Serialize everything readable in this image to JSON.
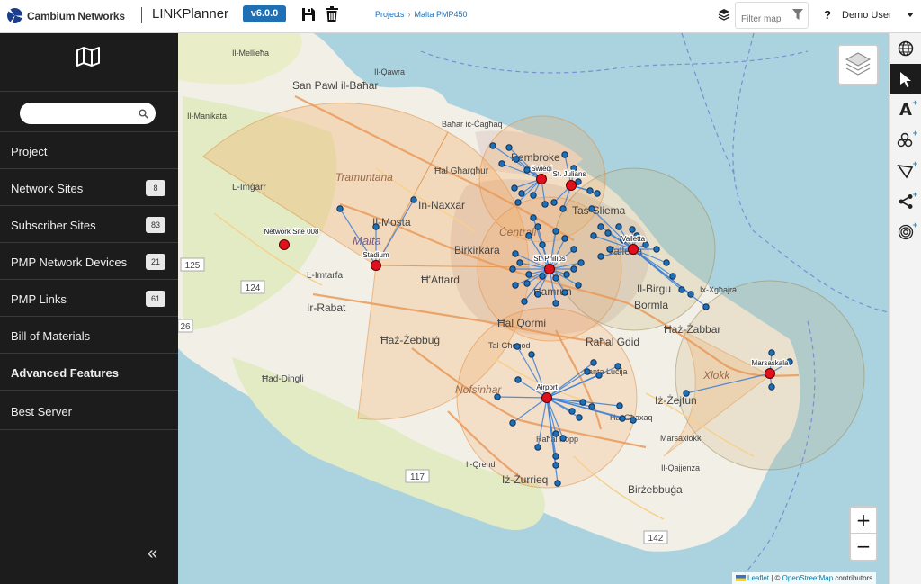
{
  "header": {
    "brand": "Cambium Networks",
    "app_title": "LINKPlanner",
    "version": "v6.0.0",
    "breadcrumb": [
      "Projects",
      "Malta PMP450"
    ],
    "filter_placeholder": "Filter map",
    "help": "?",
    "user": "Demo User",
    "icons": [
      "layers-icon",
      "save-icon",
      "trash-icon",
      "filter-icon",
      "caret-down-icon"
    ]
  },
  "sidebar": {
    "search_value": "",
    "items": [
      {
        "label": "Project",
        "badge": ""
      },
      {
        "label": "Network Sites",
        "badge": "8"
      },
      {
        "label": "Subscriber Sites",
        "badge": "83"
      },
      {
        "label": "PMP Network Devices",
        "badge": "21"
      },
      {
        "label": "PMP Links",
        "badge": "61"
      },
      {
        "label": "Bill of Materials",
        "badge": ""
      },
      {
        "label": "Advanced Features",
        "badge": ""
      },
      {
        "label": "Best Server",
        "badge": ""
      }
    ],
    "collapse": "«"
  },
  "map": {
    "place_labels": [
      "Il-Mellieħa",
      "Il-Qawra",
      "San Pawl il-Baħar",
      "Il-Manikata",
      "Baħar iċ-Ċagħaq",
      "Pembroke",
      "Ħal Għargħur",
      "Tramuntana",
      "L-Imġarr",
      "In-Naxxar",
      "Il-Mosta",
      "Tas-Sliema",
      "Birkirkara",
      "Ċentrali",
      "Malta",
      "Il-Birgu",
      "Bormla",
      "L-Imtarfa",
      "Ħ'Attard",
      "Ħamrun",
      "Ir-Rabat",
      "Ħal Qormi",
      "Ħaż-Żabbar",
      "Ħaż-Żebbuġ",
      "Raħal Ġdid",
      "Tal-Għoqod",
      "Ħad-Dingli",
      "Xlokk",
      "Iż-Żejtun",
      "Nofsinhar",
      "Ħal Għaxaq",
      "Marsaxlokk",
      "Il-Qrendi",
      "Iż-Żurrieq",
      "Il-Qajjenza",
      "Birżebbuġa",
      "Ix-Xgħajra",
      "Valletta",
      "Santa Luċija",
      "Raħal Kopp"
    ],
    "road_numbers": [
      "125",
      "124",
      "26",
      "117",
      "142"
    ],
    "site_labels": [
      "Network Site 008",
      "Stadium",
      "Swieqi",
      "St. Julians",
      "Valletta",
      "St. Philips",
      "Airport",
      "Marsaskala"
    ],
    "attribution": {
      "leaflet": "Leaflet",
      "sep": " | © ",
      "osm": "OpenStreetMap",
      "rest": " contributors"
    },
    "zoom_in": "+",
    "zoom_out": "−"
  },
  "right_tools": [
    "globe-icon",
    "pointer-icon",
    "add-text-icon",
    "add-sites-icon",
    "add-polygon-icon",
    "add-link-icon",
    "add-coverage-icon"
  ],
  "colors": {
    "accent": "#1f6fb4",
    "sidebar": "#1c1c1c",
    "network_site": "#e0101c",
    "subscriber": "#1f6fb4",
    "coverage": "#f5a65b"
  }
}
